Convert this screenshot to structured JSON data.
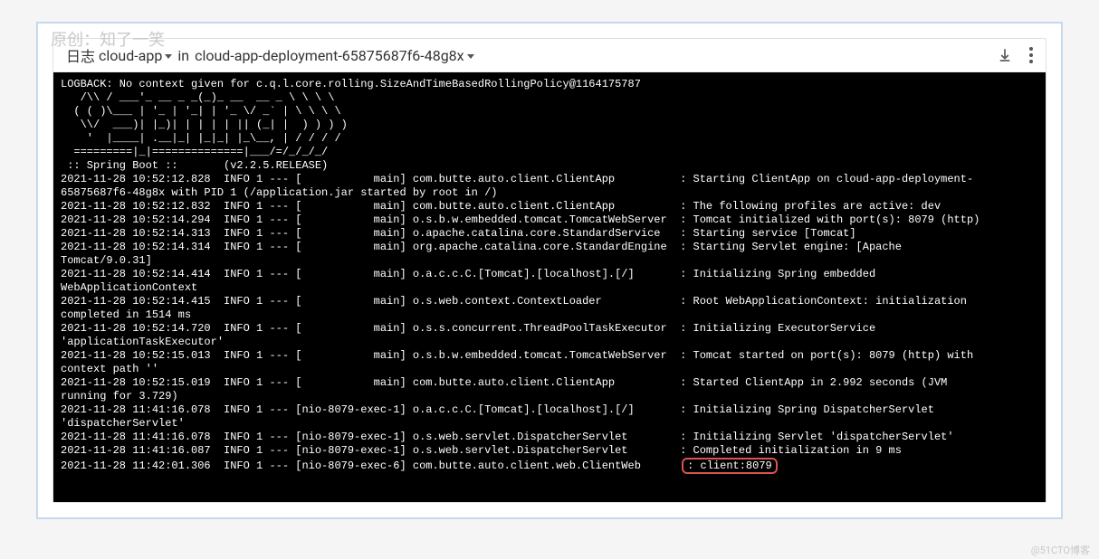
{
  "watermarks": {
    "top": "原创：知了一笑",
    "bottom": "@51CTO博客"
  },
  "header": {
    "log_label": "日志",
    "app_selector": "cloud-app",
    "in_label": "in",
    "pod_selector": "cloud-app-deployment-65875687f6-48g8x"
  },
  "banner": {
    "line0": "LOGBACK: No context given for c.q.l.core.rolling.SizeAndTimeBasedRollingPolicy@1164175787",
    "art1": "   /\\\\ / ___'_ __ _ _(_)_ __  __ _ \\ \\ \\ \\",
    "art2": "  ( ( )\\___ | '_ | '_| | '_ \\/ _` | \\ \\ \\ \\",
    "art3": "   \\\\/  ___)| |_)| | | | | || (_| |  ) ) ) )",
    "art4": "    '  |____| .__|_| |_|_| |_\\__, | / / / /",
    "art5": "  =========|_|==============|___/=/_/_/_/",
    "boot": " :: Spring Boot ::       (v2.2.5.RELEASE)"
  },
  "logs": {
    "r1": "2021-11-28 10:52:12.828  INFO 1 --- [           main] com.butte.auto.client.ClientApp          : Starting ClientApp on cloud-app-deployment-",
    "r1b": "65875687f6-48g8x with PID 1 (/application.jar started by root in /)",
    "r2": "2021-11-28 10:52:12.832  INFO 1 --- [           main] com.butte.auto.client.ClientApp          : The following profiles are active: dev",
    "r3": "2021-11-28 10:52:14.294  INFO 1 --- [           main] o.s.b.w.embedded.tomcat.TomcatWebServer  : Tomcat initialized with port(s): 8079 (http)",
    "r4": "2021-11-28 10:52:14.313  INFO 1 --- [           main] o.apache.catalina.core.StandardService   : Starting service [Tomcat]",
    "r5": "2021-11-28 10:52:14.314  INFO 1 --- [           main] org.apache.catalina.core.StandardEngine  : Starting Servlet engine: [Apache ",
    "r5b": "Tomcat/9.0.31]",
    "r6": "2021-11-28 10:52:14.414  INFO 1 --- [           main] o.a.c.c.C.[Tomcat].[localhost].[/]       : Initializing Spring embedded ",
    "r6b": "WebApplicationContext",
    "r7": "2021-11-28 10:52:14.415  INFO 1 --- [           main] o.s.web.context.ContextLoader            : Root WebApplicationContext: initialization ",
    "r7b": "completed in 1514 ms",
    "r8": "2021-11-28 10:52:14.720  INFO 1 --- [           main] o.s.s.concurrent.ThreadPoolTaskExecutor  : Initializing ExecutorService ",
    "r8b": "'applicationTaskExecutor'",
    "r9": "2021-11-28 10:52:15.013  INFO 1 --- [           main] o.s.b.w.embedded.tomcat.TomcatWebServer  : Tomcat started on port(s): 8079 (http) with ",
    "r9b": "context path ''",
    "r10": "2021-11-28 10:52:15.019  INFO 1 --- [           main] com.butte.auto.client.ClientApp          : Started ClientApp in 2.992 seconds (JVM ",
    "r10b": "running for 3.729)",
    "r11": "2021-11-28 11:41:16.078  INFO 1 --- [nio-8079-exec-1] o.a.c.c.C.[Tomcat].[localhost].[/]       : Initializing Spring DispatcherServlet ",
    "r11b": "'dispatcherServlet'",
    "r12": "2021-11-28 11:41:16.078  INFO 1 --- [nio-8079-exec-1] o.s.web.servlet.DispatcherServlet        : Initializing Servlet 'dispatcherServlet'",
    "r13": "2021-11-28 11:41:16.087  INFO 1 --- [nio-8079-exec-1] o.s.web.servlet.DispatcherServlet        : Completed initialization in 9 ms",
    "r14a": "2021-11-28 11:42:01.306  INFO 1 --- [nio-8079-exec-6] com.butte.auto.client.web.ClientWeb      ",
    "r14b": ": client:8079"
  }
}
